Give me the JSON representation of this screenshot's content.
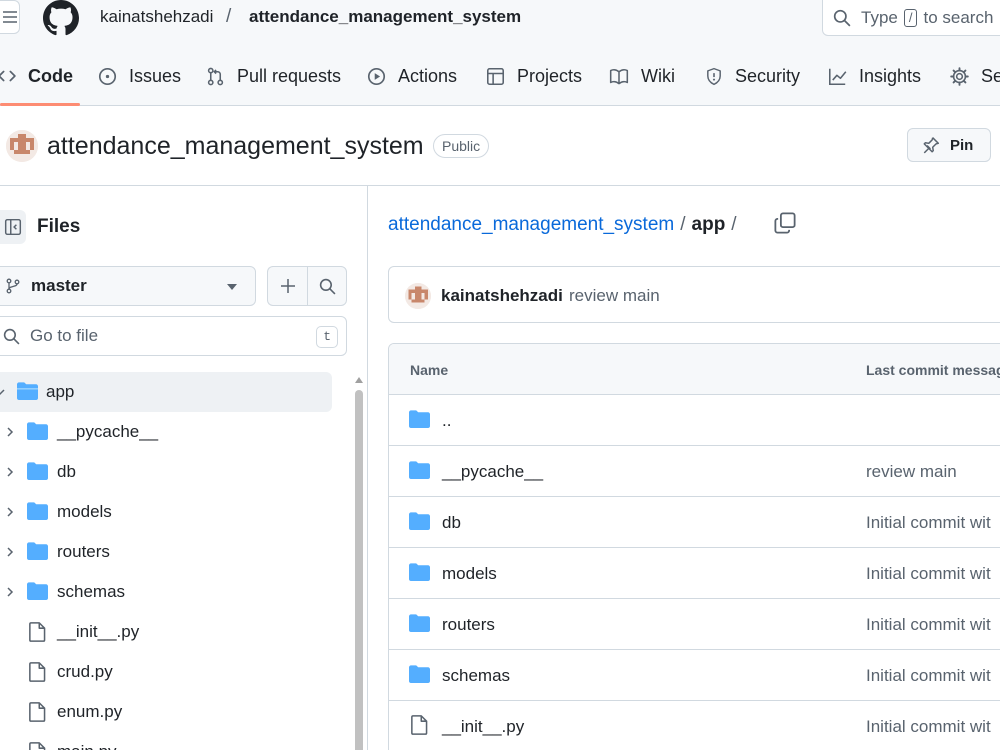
{
  "header": {
    "owner": "kainatshehzadi",
    "separator": "/",
    "repo": "attendance_management_system",
    "search": {
      "prefix": "Type",
      "key": "/",
      "suffix": "to search"
    }
  },
  "tabs": [
    {
      "label": "Code",
      "icon": "code-icon",
      "selected": true
    },
    {
      "label": "Issues",
      "icon": "issue-opened-icon"
    },
    {
      "label": "Pull requests",
      "icon": "git-pull-request-icon"
    },
    {
      "label": "Actions",
      "icon": "play-icon"
    },
    {
      "label": "Projects",
      "icon": "table-icon"
    },
    {
      "label": "Wiki",
      "icon": "book-icon"
    },
    {
      "label": "Security",
      "icon": "shield-icon"
    },
    {
      "label": "Insights",
      "icon": "graph-icon"
    },
    {
      "label": "Se",
      "icon": "gear-icon"
    }
  ],
  "repo_header": {
    "title": "attendance_management_system",
    "visibility": "Public",
    "pin_label": "Pin"
  },
  "sidebar": {
    "title": "Files",
    "branch": "master",
    "goto_placeholder": "Go to file",
    "goto_key": "t",
    "tree": [
      {
        "label": "app",
        "type": "folder",
        "open": true,
        "active": true,
        "depth": 0
      },
      {
        "label": "__pycache__",
        "type": "folder",
        "depth": 1
      },
      {
        "label": "db",
        "type": "folder",
        "depth": 1
      },
      {
        "label": "models",
        "type": "folder",
        "depth": 1
      },
      {
        "label": "routers",
        "type": "folder",
        "depth": 1
      },
      {
        "label": "schemas",
        "type": "folder",
        "depth": 1
      },
      {
        "label": "__init__.py",
        "type": "file",
        "depth": 1
      },
      {
        "label": "crud.py",
        "type": "file",
        "depth": 1
      },
      {
        "label": "enum.py",
        "type": "file",
        "depth": 1
      },
      {
        "label": "main.py",
        "type": "file",
        "depth": 1
      }
    ]
  },
  "main": {
    "path": {
      "root": "attendance_management_system",
      "sep": "/",
      "current": "app",
      "trail": "/"
    },
    "commit": {
      "user": "kainatshehzadi",
      "message": "review main"
    },
    "table": {
      "col_name": "Name",
      "col_commit": "Last commit messag",
      "rows": [
        {
          "name": "..",
          "type": "folder",
          "message": ""
        },
        {
          "name": "__pycache__",
          "type": "folder",
          "message": "review main"
        },
        {
          "name": "db",
          "type": "folder",
          "message": "Initial commit wit"
        },
        {
          "name": "models",
          "type": "folder",
          "message": "Initial commit wit"
        },
        {
          "name": "routers",
          "type": "folder",
          "message": "Initial commit wit"
        },
        {
          "name": "schemas",
          "type": "folder",
          "message": "Initial commit wit"
        },
        {
          "name": "__init__.py",
          "type": "file",
          "message": "Initial commit wit"
        }
      ]
    }
  },
  "colors": {
    "link": "#0969da",
    "folder": "#54aeff",
    "tab_underline": "#fd8c73",
    "border": "#d1d9e0",
    "muted": "#59636e"
  }
}
